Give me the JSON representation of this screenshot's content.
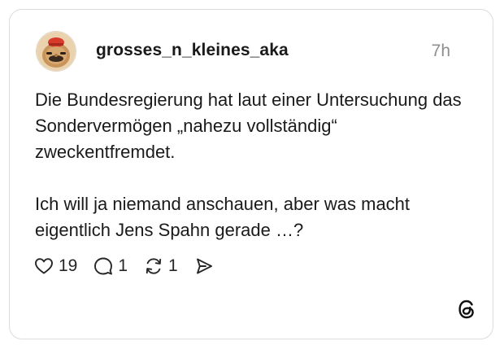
{
  "post": {
    "username": "grosses_n_kleines_aka",
    "timestamp": "7h",
    "paragraphs": [
      "Die Bundesregierung hat laut einer Untersuchung das Sondervermögen „nahezu vollständig“ zweckentfremdet.",
      "Ich will ja niemand anschauen, aber was macht eigentlich Jens Spahn gerade …?"
    ]
  },
  "actions": {
    "likes": "19",
    "replies": "1",
    "reposts": "1"
  },
  "icons": {
    "like": "heart-icon",
    "reply": "comment-bubble-icon",
    "repost": "repost-icon",
    "share": "share-send-icon",
    "brand": "threads-logo-icon"
  },
  "colors": {
    "text": "#1a1a1a",
    "muted": "#8e8e8e",
    "border": "#dcdcdc"
  }
}
